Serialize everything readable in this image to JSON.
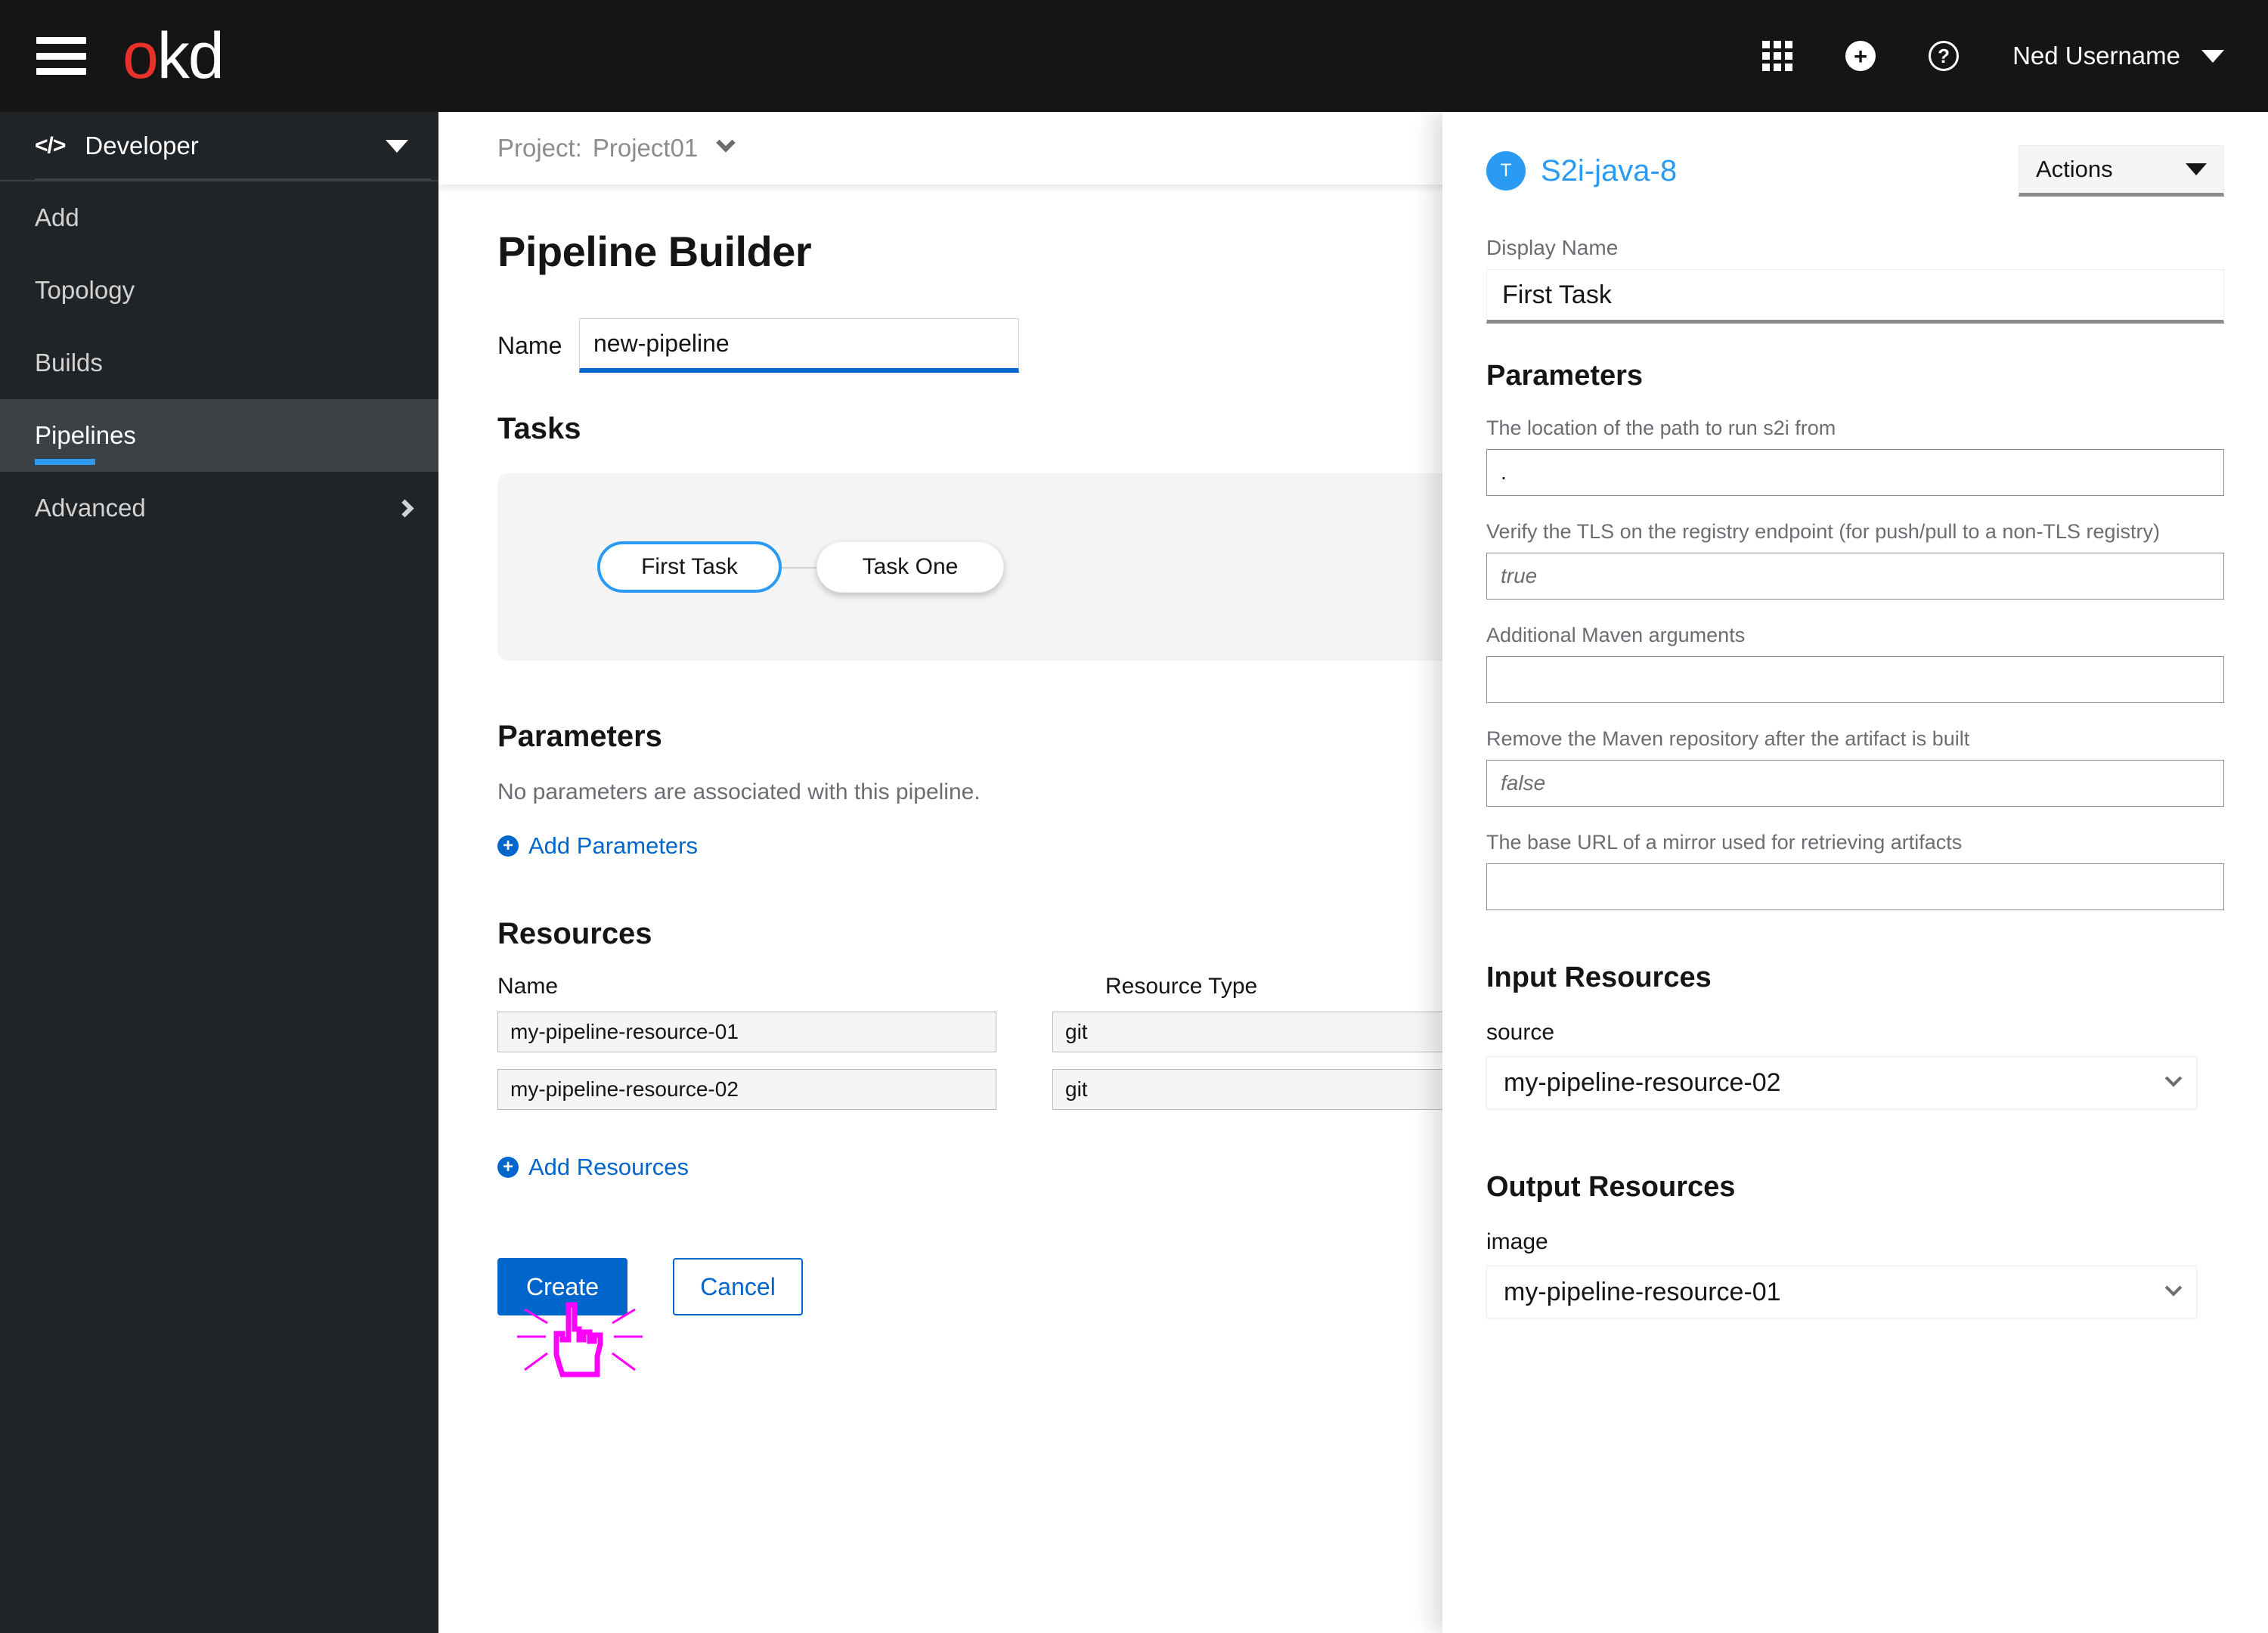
{
  "masthead": {
    "menu_icon": "hamburger-icon",
    "logo_first": "o",
    "logo_rest": "kd",
    "apps_icon": "grid-icon",
    "add_icon": "plus-circle-icon",
    "add_glyph": "+",
    "help_icon": "question-circle-icon",
    "help_glyph": "?",
    "username": "Ned Username",
    "user_caret_icon": "caret-down-icon"
  },
  "sidebar": {
    "perspective": {
      "icon": "code-icon",
      "icon_glyph": "</>",
      "label": "Developer",
      "caret_icon": "caret-down-icon"
    },
    "items": [
      {
        "label": "Add",
        "active": false
      },
      {
        "label": "Topology",
        "active": false
      },
      {
        "label": "Builds",
        "active": false
      },
      {
        "label": "Pipelines",
        "active": true
      },
      {
        "label": "Advanced",
        "active": false,
        "chevron": "chevron-right-icon"
      }
    ]
  },
  "project_bar": {
    "label": "Project:",
    "name": "Project01",
    "caret_icon": "chevron-down-icon"
  },
  "main": {
    "page_title": "Pipeline Builder",
    "name_label": "Name",
    "name_value": "new-pipeline",
    "tasks": {
      "title": "Tasks",
      "nodes": [
        {
          "label": "First Task",
          "selected": true
        },
        {
          "label": "Task One",
          "selected": false
        }
      ]
    },
    "parameters": {
      "title": "Parameters",
      "empty_text": "No parameters are associated with this pipeline.",
      "add_link": "Add Parameters",
      "add_icon": "plus-circle-icon"
    },
    "resources": {
      "title": "Resources",
      "columns": [
        "Name",
        "Resource Type"
      ],
      "rows": [
        {
          "name": "my-pipeline-resource-01",
          "type": "git"
        },
        {
          "name": "my-pipeline-resource-02",
          "type": "git"
        }
      ],
      "add_link": "Add Resources",
      "add_icon": "plus-circle-icon"
    },
    "buttons": {
      "create": "Create",
      "cancel": "Cancel"
    },
    "cursor_annotation": {
      "icon": "click-pointer-cursor-icon",
      "color": "#f0f"
    }
  },
  "drawer": {
    "badge_letter": "T",
    "title": "S2i-java-8",
    "actions_label": "Actions",
    "actions_caret_icon": "caret-down-icon",
    "display_name_label": "Display Name",
    "display_name_value": "First Task",
    "parameters_title": "Parameters",
    "parameters": [
      {
        "label": "The location of the path to run s2i from",
        "value": ".",
        "is_placeholder": false
      },
      {
        "label": "Verify the TLS on the registry endpoint (for push/pull to a non-TLS registry)",
        "value": "true",
        "is_placeholder": true
      },
      {
        "label": "Additional Maven arguments",
        "value": "",
        "is_placeholder": false
      },
      {
        "label": "Remove the Maven repository after the artifact is built",
        "value": "false",
        "is_placeholder": true
      },
      {
        "label": "The base URL of a mirror used for retrieving artifacts",
        "value": "",
        "is_placeholder": false
      }
    ],
    "input_resources": {
      "title": "Input Resources",
      "items": [
        {
          "label": "source",
          "value": "my-pipeline-resource-02"
        }
      ]
    },
    "output_resources": {
      "title": "Output Resources",
      "items": [
        {
          "label": "image",
          "value": "my-pipeline-resource-01"
        }
      ]
    }
  },
  "colors": {
    "masthead_bg": "#151515",
    "sidebar_bg": "#212427",
    "sidebar_active_bg": "#3c4145",
    "accent_blue": "#06c",
    "link_blue": "#2b9af3",
    "logo_red": "#e8312a",
    "cursor_magenta": "#ff00ff"
  }
}
